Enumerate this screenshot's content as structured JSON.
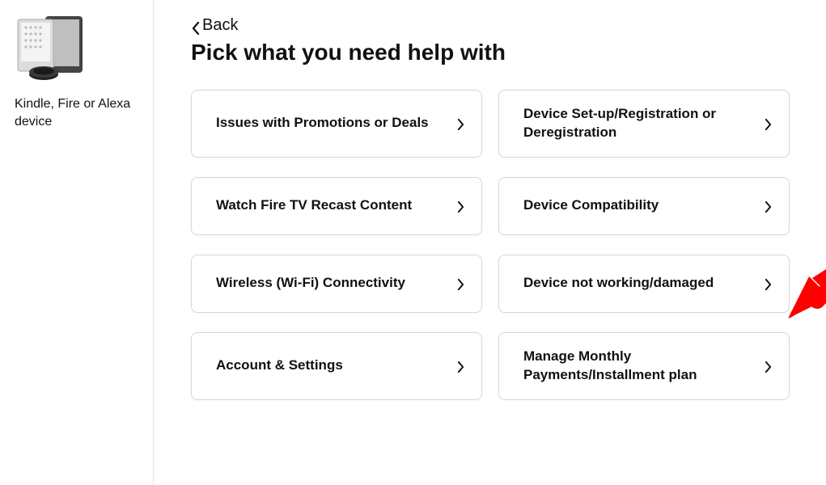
{
  "sidebar": {
    "label": "Kindle, Fire or Alexa device"
  },
  "back": {
    "label": "Back"
  },
  "title": "Pick what you need help with",
  "topics": {
    "promotions": "Issues with Promotions or Deals",
    "setup": "Device Set-up/Registration or Deregistration",
    "recast": "Watch Fire TV Recast Content",
    "compatibility": "Device Compatibility",
    "wifi": "Wireless (Wi-Fi) Connectivity",
    "notworking": "Device not working/damaged",
    "account": "Account & Settings",
    "payments": "Manage Monthly Payments/Installment plan"
  }
}
